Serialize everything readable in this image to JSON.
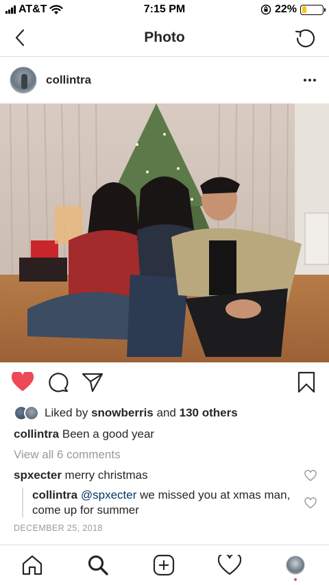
{
  "status_bar": {
    "carrier": "AT&T",
    "time": "7:15 PM",
    "battery": "22%",
    "battery_level": 0.22,
    "icons": [
      "signal-icon",
      "wifi-icon",
      "orientation-lock-icon",
      "battery-icon"
    ]
  },
  "nav": {
    "title": "Photo",
    "left_icon": "back-arrow-icon",
    "right_icon": "refresh-icon"
  },
  "post": {
    "username": "collintra",
    "more_icon": "more-options-icon",
    "photo_alt": "Four people sitting on the floor in front of a lit Christmas tree"
  },
  "actions": {
    "like_icon": "heart-filled-icon",
    "comment_icon": "comment-icon",
    "share_icon": "share-icon",
    "save_icon": "bookmark-icon",
    "liked": true,
    "like_color": "#ed4956"
  },
  "likes": {
    "prefix": "Liked by",
    "user": "snowberris",
    "and": "and",
    "others": "130 others"
  },
  "caption": {
    "username": "collintra",
    "text": "Been a good year"
  },
  "view_all": "View all 6 comments",
  "comments": [
    {
      "username": "spxecter",
      "text": "merry christmas"
    }
  ],
  "reply": {
    "username": "collintra",
    "mention": "@spxecter",
    "text": "we missed you at xmas man, come up for summer"
  },
  "date": "DECEMBER 25, 2018",
  "tab_bar": {
    "tabs": [
      "home-icon",
      "search-icon",
      "new-post-icon",
      "activity-icon",
      "profile-avatar"
    ]
  }
}
